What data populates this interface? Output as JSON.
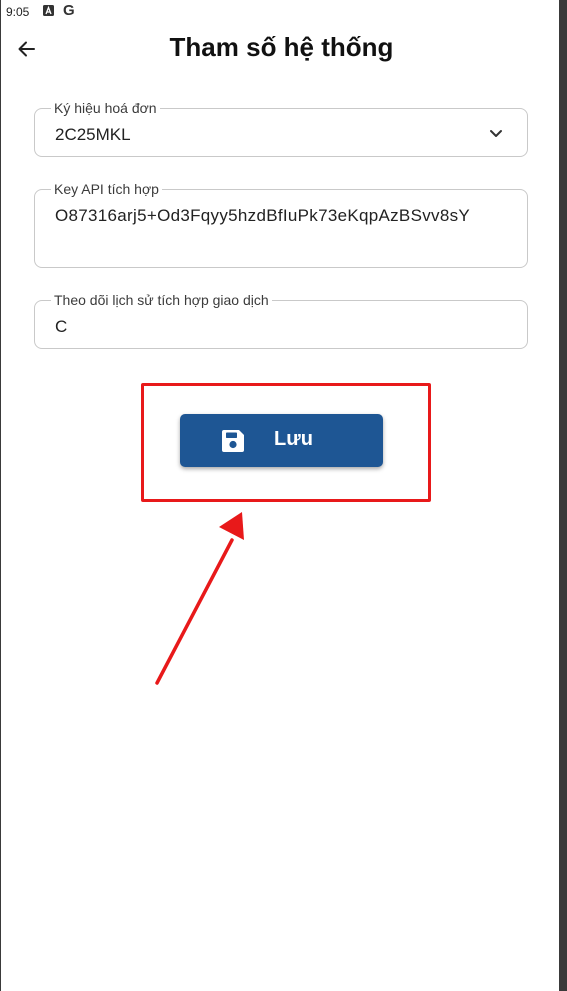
{
  "status_bar": {
    "time": "9:05",
    "icons": [
      "a-box-icon",
      "google-g-icon"
    ],
    "google_letter": "G"
  },
  "header": {
    "title": "Tham số hệ thống",
    "back_icon": "arrow-left-icon"
  },
  "form": {
    "invoice_symbol": {
      "label": "Ký hiệu hoá đơn",
      "value": "2C25MKL",
      "icon": "chevron-down-icon"
    },
    "api_key": {
      "label": "Key API tích hợp",
      "value": "O87316arj5+Od3Fqyy5hzdBfIuPk73eKqpAzBSvv8sY"
    },
    "transaction_history": {
      "label": "Theo dõi lịch sử tích hợp giao dịch",
      "value": "C"
    }
  },
  "save_button": {
    "label": "Lưu",
    "icon": "floppy-disk-icon"
  },
  "colors": {
    "primary": "#1e5694",
    "highlight": "#e8191a"
  }
}
